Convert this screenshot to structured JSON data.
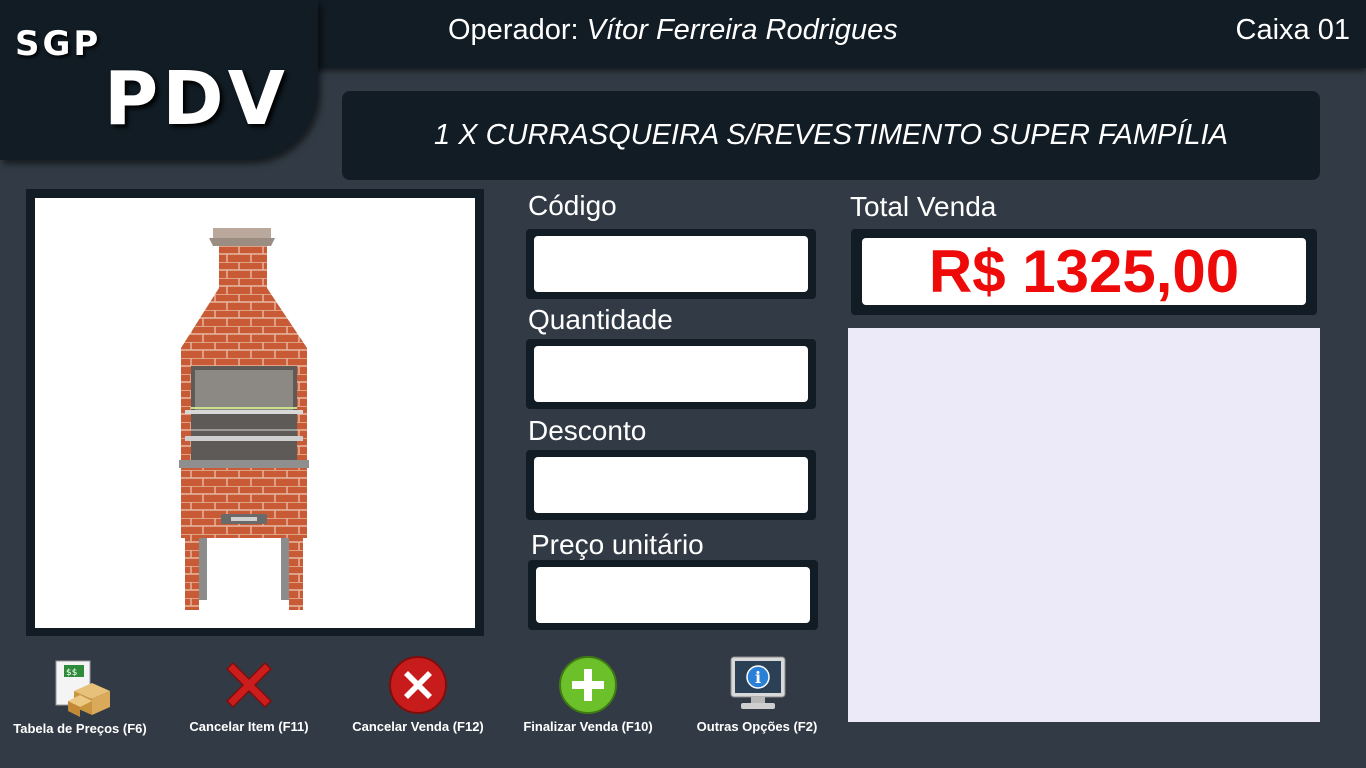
{
  "header": {
    "logo_small": "SGP",
    "logo_big": "PDV",
    "operator_label": "Operador:",
    "operator_name": "Vítor Ferreira Rodrigues",
    "register": "Caixa 01"
  },
  "current_item": "1 X CURRASQUEIRA S/REVESTIMENTO SUPER FAMPÍLIA",
  "product_image": {
    "icon": "barbecue-grill-icon"
  },
  "fields": {
    "codigo": {
      "label": "Código",
      "value": ""
    },
    "quantidade": {
      "label": "Quantidade",
      "value": ""
    },
    "desconto": {
      "label": "Desconto",
      "value": ""
    },
    "preco_unitario": {
      "label": "Preço unitário",
      "value": ""
    }
  },
  "total": {
    "label": "Total Venda",
    "value": "R$ 1325,00",
    "color": "#ef0a0a"
  },
  "toolbar": {
    "price_table": {
      "label": "Tabela de Preços (F6)",
      "icon": "price-table-icon"
    },
    "cancel_item": {
      "label": "Cancelar Item (F11)",
      "icon": "red-x-icon"
    },
    "cancel_sale": {
      "label": "Cancelar Venda (F12)",
      "icon": "cancel-circle-icon"
    },
    "finish_sale": {
      "label": "Finalizar Venda (F10)",
      "icon": "plus-circle-icon"
    },
    "other_options": {
      "label": "Outras Opções (F2)",
      "icon": "info-monitor-icon"
    }
  },
  "colors": {
    "background": "#323b45",
    "panel": "#111c24",
    "items_list_bg": "#eceaf8",
    "total_text": "#ef0a0a"
  }
}
